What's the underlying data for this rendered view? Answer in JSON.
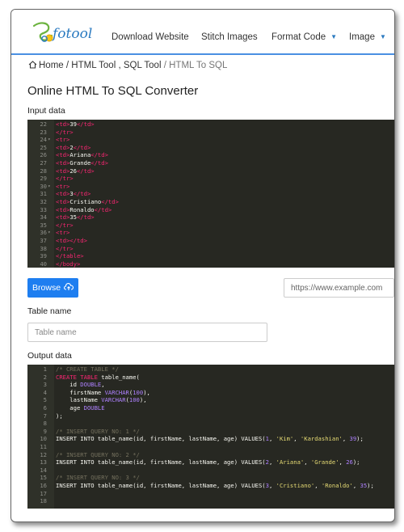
{
  "brand": {
    "logo_text": "fotool"
  },
  "nav": {
    "items": [
      {
        "label": "Download Website",
        "dropdown": false
      },
      {
        "label": "Stitch Images",
        "dropdown": false
      },
      {
        "label": "Format Code",
        "dropdown": true
      },
      {
        "label": "Image",
        "dropdown": true
      }
    ],
    "caret": "▼"
  },
  "breadcrumb": {
    "home": "Home",
    "sep1": "/",
    "section": "HTML Tool , SQL Tool",
    "sep2": "/",
    "current": "HTML To SQL"
  },
  "page": {
    "title": "Online HTML To SQL Converter",
    "input_label": "Input data",
    "table_name_label": "Table name",
    "output_label": "Output data"
  },
  "controls": {
    "browse_label": "Browse",
    "url_placeholder": "https://www.example.com",
    "table_name_placeholder": "Table name"
  },
  "input_editor": {
    "lines": [
      {
        "n": "22",
        "fold": false,
        "tokens": [
          [
            "t",
            "<td>"
          ],
          [
            "p",
            "39"
          ],
          [
            "t",
            "</td>"
          ]
        ]
      },
      {
        "n": "23",
        "fold": false,
        "tokens": [
          [
            "t",
            "</tr>"
          ]
        ]
      },
      {
        "n": "24",
        "fold": true,
        "tokens": [
          [
            "t",
            "<tr>"
          ]
        ]
      },
      {
        "n": "25",
        "fold": false,
        "tokens": [
          [
            "t",
            "<td>"
          ],
          [
            "p",
            "2"
          ],
          [
            "t",
            "</td>"
          ]
        ]
      },
      {
        "n": "26",
        "fold": false,
        "tokens": [
          [
            "t",
            "<td>"
          ],
          [
            "p",
            "Ariana"
          ],
          [
            "t",
            "</td>"
          ]
        ]
      },
      {
        "n": "27",
        "fold": false,
        "tokens": [
          [
            "t",
            "<td>"
          ],
          [
            "p",
            "Grande"
          ],
          [
            "t",
            "</td>"
          ]
        ]
      },
      {
        "n": "28",
        "fold": false,
        "tokens": [
          [
            "t",
            "<td>"
          ],
          [
            "p",
            "26"
          ],
          [
            "t",
            "</td>"
          ]
        ]
      },
      {
        "n": "29",
        "fold": false,
        "tokens": [
          [
            "t",
            "</tr>"
          ]
        ]
      },
      {
        "n": "30",
        "fold": true,
        "tokens": [
          [
            "t",
            "<tr>"
          ]
        ]
      },
      {
        "n": "31",
        "fold": false,
        "tokens": [
          [
            "t",
            "<td>"
          ],
          [
            "p",
            "3"
          ],
          [
            "t",
            "</td>"
          ]
        ]
      },
      {
        "n": "32",
        "fold": false,
        "tokens": [
          [
            "t",
            "<td>"
          ],
          [
            "p",
            "Cristiano"
          ],
          [
            "t",
            "</td>"
          ]
        ]
      },
      {
        "n": "33",
        "fold": false,
        "tokens": [
          [
            "t",
            "<td>"
          ],
          [
            "p",
            "Ronaldo"
          ],
          [
            "t",
            "</td>"
          ]
        ]
      },
      {
        "n": "34",
        "fold": false,
        "tokens": [
          [
            "t",
            "<td>"
          ],
          [
            "p",
            "35"
          ],
          [
            "t",
            "</td>"
          ]
        ]
      },
      {
        "n": "35",
        "fold": false,
        "tokens": [
          [
            "t",
            "</tr>"
          ]
        ]
      },
      {
        "n": "36",
        "fold": true,
        "tokens": [
          [
            "t",
            "<tr>"
          ]
        ]
      },
      {
        "n": "37",
        "fold": false,
        "tokens": [
          [
            "t",
            "<td></td>"
          ]
        ]
      },
      {
        "n": "38",
        "fold": false,
        "tokens": [
          [
            "t",
            "</tr>"
          ]
        ]
      },
      {
        "n": "39",
        "fold": false,
        "tokens": [
          [
            "t",
            "</table>"
          ]
        ]
      },
      {
        "n": "40",
        "fold": false,
        "tokens": [
          [
            "t",
            "</body>"
          ]
        ]
      }
    ]
  },
  "output_editor": {
    "lines": [
      {
        "n": "1",
        "tokens": [
          [
            "c",
            "/* CREATE TABLE */"
          ]
        ]
      },
      {
        "n": "2",
        "tokens": [
          [
            "k",
            "CREATE TABLE"
          ],
          [
            "p",
            " table_name("
          ]
        ]
      },
      {
        "n": "3",
        "tokens": [
          [
            "p",
            "    id "
          ],
          [
            "y",
            "DOUBLE"
          ],
          [
            "p",
            ","
          ]
        ]
      },
      {
        "n": "4",
        "tokens": [
          [
            "p",
            "    firstName "
          ],
          [
            "y",
            "VARCHAR"
          ],
          [
            "p",
            "("
          ],
          [
            "u",
            "100"
          ],
          [
            "p",
            "),"
          ]
        ]
      },
      {
        "n": "5",
        "tokens": [
          [
            "p",
            "    lastName "
          ],
          [
            "y",
            "VARCHAR"
          ],
          [
            "p",
            "("
          ],
          [
            "u",
            "100"
          ],
          [
            "p",
            "),"
          ]
        ]
      },
      {
        "n": "6",
        "tokens": [
          [
            "p",
            "    age "
          ],
          [
            "y",
            "DOUBLE"
          ]
        ]
      },
      {
        "n": "7",
        "tokens": [
          [
            "p",
            ");"
          ]
        ]
      },
      {
        "n": "8",
        "tokens": []
      },
      {
        "n": "9",
        "tokens": [
          [
            "c",
            "/* INSERT QUERY NO: 1 */"
          ]
        ]
      },
      {
        "n": "10",
        "tokens": [
          [
            "p",
            "INSERT INTO table_name(id, firstName, lastName, age) VALUES("
          ],
          [
            "u",
            "1"
          ],
          [
            "p",
            ", "
          ],
          [
            "s",
            "'Kim'"
          ],
          [
            "p",
            ", "
          ],
          [
            "s",
            "'Kardashian'"
          ],
          [
            "p",
            ", "
          ],
          [
            "u",
            "39"
          ],
          [
            "p",
            ");"
          ]
        ]
      },
      {
        "n": "11",
        "tokens": []
      },
      {
        "n": "12",
        "tokens": [
          [
            "c",
            "/* INSERT QUERY NO: 2 */"
          ]
        ]
      },
      {
        "n": "13",
        "tokens": [
          [
            "p",
            "INSERT INTO table_name(id, firstName, lastName, age) VALUES("
          ],
          [
            "u",
            "2"
          ],
          [
            "p",
            ", "
          ],
          [
            "s",
            "'Ariana'"
          ],
          [
            "p",
            ", "
          ],
          [
            "s",
            "'Grande'"
          ],
          [
            "p",
            ", "
          ],
          [
            "u",
            "26"
          ],
          [
            "p",
            ");"
          ]
        ]
      },
      {
        "n": "14",
        "tokens": []
      },
      {
        "n": "15",
        "tokens": [
          [
            "c",
            "/* INSERT QUERY NO: 3 */"
          ]
        ]
      },
      {
        "n": "16",
        "tokens": [
          [
            "p",
            "INSERT INTO table_name(id, firstName, lastName, age) VALUES("
          ],
          [
            "u",
            "3"
          ],
          [
            "p",
            ", "
          ],
          [
            "s",
            "'Cristiano'"
          ],
          [
            "p",
            ", "
          ],
          [
            "s",
            "'Ronaldo'"
          ],
          [
            "p",
            ", "
          ],
          [
            "u",
            "35"
          ],
          [
            "p",
            ");"
          ]
        ]
      },
      {
        "n": "17",
        "tokens": []
      },
      {
        "n": "18",
        "tokens": []
      }
    ]
  },
  "colors": {
    "accent": "#1e7ef0",
    "editor_bg": "#272822",
    "tag": "#f92672",
    "comment": "#75715e",
    "string": "#e6db74",
    "number": "#ae81ff"
  }
}
